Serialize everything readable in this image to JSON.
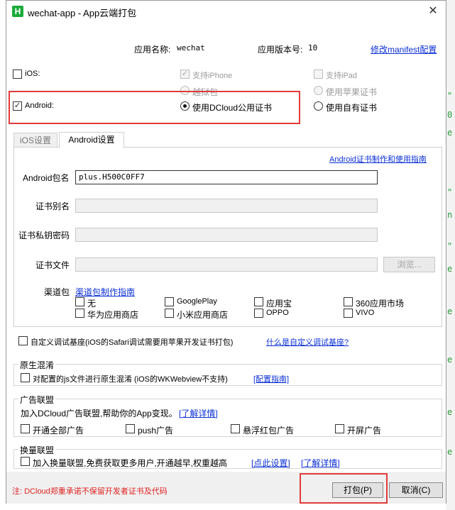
{
  "window": {
    "title": "wechat-app - App云端打包",
    "logo": "H",
    "close": "✕"
  },
  "appinfo": {
    "name_label": "应用名称:",
    "name_value": "wechat",
    "version_label": "应用版本号:",
    "version_value": "10",
    "manifest_link": "修改manifest配置"
  },
  "ios": {
    "label": "iOS:",
    "checked": false,
    "support_iphone": "支持iPhone",
    "support_ipad": "支持iPad",
    "jailbreak": "越狱包",
    "apple_cert": "使用苹果证书"
  },
  "android": {
    "label": "Android:",
    "checked": true,
    "dcloud_cert": "使用DCloud公用证书",
    "own_cert": "使用自有证书"
  },
  "tabs": [
    "iOS设置",
    "Android设置"
  ],
  "android_tab": {
    "guide_link": "Android证书制作和使用指南",
    "package_label": "Android包名",
    "package_value": "plus.H500C0FF7",
    "alias_label": "证书别名",
    "password_label": "证书私钥密码",
    "file_label": "证书文件",
    "browse_button": "浏览...",
    "channel_label": "渠道包",
    "channel_link": "渠道包制作指南",
    "channels": [
      "无",
      "GooglePlay",
      "应用宝",
      "360应用市场",
      "华为应用商店",
      "小米应用商店",
      "OPPO",
      "VIVO"
    ]
  },
  "custom_base": {
    "label": "自定义调试基座(iOS的Safari调试需要用苹果开发证书打包)",
    "link": "什么是自定义调试基座?"
  },
  "obfuscation": {
    "title": "原生混淆",
    "label": "对配置的js文件进行原生混淆 (iOS的WKWebview不支持)",
    "link": "[配置指南]"
  },
  "ads": {
    "title": "广告联盟",
    "desc": "加入DCloud广告联盟,帮助你的App变现。",
    "link": "[了解详情]",
    "options": [
      "开通全部广告",
      "push广告",
      "悬浮红包广告",
      "开屏广告"
    ]
  },
  "exchange": {
    "title": "换量联盟",
    "label": "加入换量联盟,免费获取更多用户,开通越早,权重越高",
    "link1": "[点此设置]",
    "link2": "[了解详情]"
  },
  "footer": {
    "note": "注: DCloud郑重承诺不保留开发者证书及代码",
    "pack_button": "打包(P)",
    "cancel_button": "取消(C)"
  },
  "colors": {
    "accent_red": "#e23a3a",
    "link_blue": "#0b30d6",
    "logo_green": "#1aab3a"
  }
}
